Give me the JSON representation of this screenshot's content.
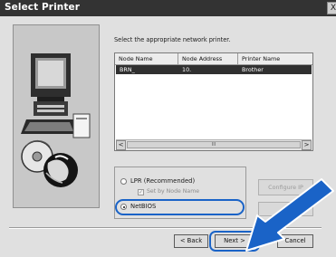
{
  "window": {
    "title": "Select Printer",
    "close_glyph": "X"
  },
  "main": {
    "prompt": "Select the appropriate network printer.",
    "columns": [
      "Node Name",
      "Node Address",
      "Printer Name"
    ],
    "rows": [
      {
        "node_name": "BRN_",
        "node_address": "10.",
        "printer_name": "Brother",
        "selected": true
      }
    ],
    "scroll_left_glyph": "<",
    "scroll_right_glyph": ">",
    "scroll_thumb_glyph": "III"
  },
  "options": {
    "lpr_label": "LPR (Recommended)",
    "set_by_node_label": "Set by Node Name",
    "netbios_label": "NetBIOS",
    "selected": "NetBIOS"
  },
  "buttons": {
    "configure_ip": "Configure IP",
    "back": "< Back",
    "next": "Next >",
    "cancel": "Cancel"
  },
  "colors": {
    "highlight": "#1a63c7",
    "selection": "#303030",
    "titlebar": "#333333"
  }
}
